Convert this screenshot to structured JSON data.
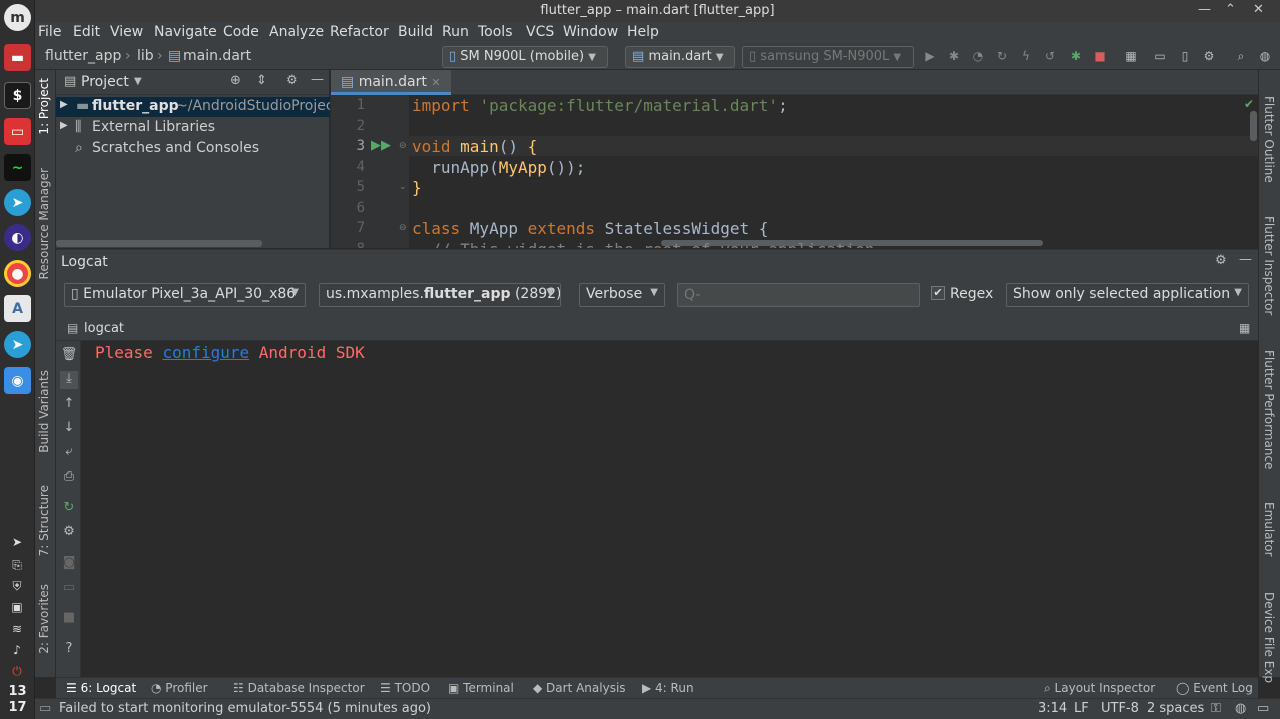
{
  "window": {
    "title": "flutter_app – main.dart [flutter_app]"
  },
  "menu": [
    "File",
    "Edit",
    "View",
    "Navigate",
    "Code",
    "Analyze",
    "Refactor",
    "Build",
    "Run",
    "Tools",
    "VCS",
    "Window",
    "Help"
  ],
  "breadcrumb": {
    "project": "flutter_app",
    "folder": "lib",
    "file": "main.dart"
  },
  "toolbar": {
    "device": "SM N900L (mobile)",
    "run_config": "main.dart",
    "target_device": "samsung SM-N900L"
  },
  "left_tabs": {
    "project": "1: Project",
    "resource": "Resource Manager",
    "build_variants": "Build Variants",
    "structure": "7: Structure",
    "favorites": "2: Favorites"
  },
  "right_tabs": {
    "outline": "Flutter Outline",
    "inspector": "Flutter Inspector",
    "performance": "Flutter Performance",
    "emulator": "Emulator",
    "device_files": "Device File Exp"
  },
  "project_panel": {
    "title": "Project",
    "items": [
      {
        "name": "flutter_app",
        "path": "~/AndroidStudioProject"
      },
      {
        "name": "External Libraries"
      },
      {
        "name": "Scratches and Consoles"
      }
    ]
  },
  "editor": {
    "tab": "main.dart",
    "lines": [
      {
        "n": "1",
        "parts": [
          [
            "kw",
            "import "
          ],
          [
            "str",
            "'package:flutter/material.dart'"
          ],
          [
            "",
            ";"
          ]
        ]
      },
      {
        "n": "2",
        "parts": []
      },
      {
        "n": "3",
        "parts": [
          [
            "kw",
            "void "
          ],
          [
            "fn",
            "main"
          ],
          [
            "",
            "() "
          ],
          [
            "fn",
            "{"
          ]
        ]
      },
      {
        "n": "4",
        "parts": [
          [
            "",
            "  runApp("
          ],
          [
            "fn",
            "MyApp"
          ],
          [
            "",
            "());"
          ]
        ]
      },
      {
        "n": "5",
        "parts": [
          [
            "fn",
            "}"
          ]
        ]
      },
      {
        "n": "6",
        "parts": []
      },
      {
        "n": "7",
        "parts": [
          [
            "kw",
            "class "
          ],
          [
            "",
            "MyApp "
          ],
          [
            "kw",
            "extends "
          ],
          [
            "",
            "StatelessWidget {"
          ]
        ]
      },
      {
        "n": "8",
        "parts": [
          [
            "cm",
            "  // This widget is the root of your application."
          ]
        ]
      }
    ]
  },
  "logcat": {
    "title": "Logcat",
    "device": "Emulator Pixel_3a_API_30_x86",
    "process_prefix": "us.mxamples.",
    "process_name": "flutter_app",
    "process_suffix": " (2892) [",
    "level": "Verbose",
    "search_placeholder": "Q-",
    "regex_label": "Regex",
    "filter": "Show only selected application",
    "tab": "logcat",
    "message_pre": "Please ",
    "message_link": "configure",
    "message_post": " Android SDK"
  },
  "bottom_tabs": [
    {
      "label": "6: Logcat"
    },
    {
      "label": "Profiler"
    },
    {
      "label": "Database Inspector"
    },
    {
      "label": "TODO"
    },
    {
      "label": "Terminal"
    },
    {
      "label": "Dart Analysis"
    },
    {
      "label": "4: Run"
    }
  ],
  "bottom_right_tabs": {
    "layout": "Layout Inspector",
    "events": "Event Log"
  },
  "status": {
    "message": "Failed to start monitoring emulator-5554 (5 minutes ago)",
    "position": "3:14",
    "line_sep": "LF",
    "encoding": "UTF-8",
    "indent": "2 spaces"
  },
  "clock": {
    "hour": "13",
    "minute": "17"
  },
  "colors": {
    "keyword": "#cc7832",
    "string": "#6a8759",
    "function": "#ffc66d",
    "error": "#ff6b68",
    "link": "#287bde"
  }
}
